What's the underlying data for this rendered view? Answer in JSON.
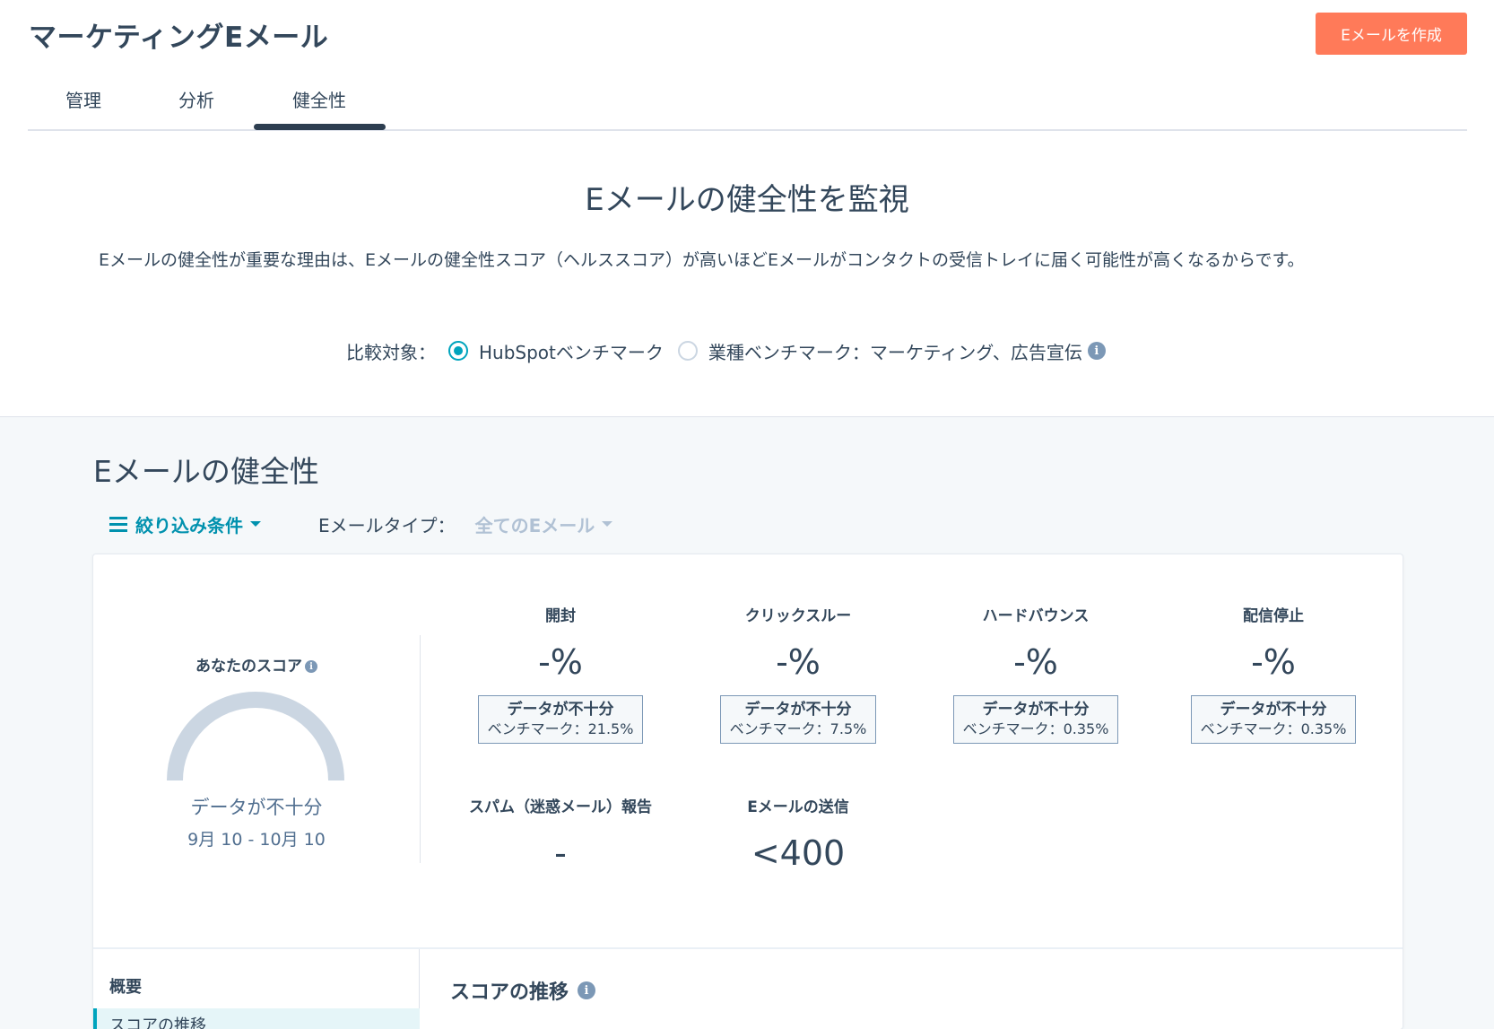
{
  "header": {
    "title": "マーケティングEメール",
    "create_button": "Eメールを作成"
  },
  "tabs": [
    {
      "label": "管理",
      "active": false
    },
    {
      "label": "分析",
      "active": false
    },
    {
      "label": "健全性",
      "active": true
    }
  ],
  "intro": {
    "title": "Eメールの健全性を監視",
    "description": "Eメールの健全性が重要な理由は、Eメールの健全性スコア（ヘルススコア）が高いほどEメールがコンタクトの受信トレイに届く可能性が高くなるからです。",
    "compare_label": "比較対象：",
    "options": [
      {
        "label": "HubSpotベンチマーク",
        "selected": true
      },
      {
        "label": "業種ベンチマーク：マーケティング、広告宣伝",
        "selected": false
      }
    ]
  },
  "health": {
    "title": "Eメールの健全性",
    "filter_label": "絞り込み条件",
    "email_type_label": "Eメールタイプ：",
    "email_type_value": "全てのEメール",
    "score": {
      "title": "あなたのスコア",
      "status": "データが不十分",
      "range": "9月 10 - 10月 10"
    },
    "metrics": [
      {
        "label": "開封",
        "value": "-%",
        "bench_title": "データが不十分",
        "bench_value": "ベンチマーク：21.5%"
      },
      {
        "label": "クリックスルー",
        "value": "-%",
        "bench_title": "データが不十分",
        "bench_value": "ベンチマーク：7.5%"
      },
      {
        "label": "ハードバウンス",
        "value": "-%",
        "bench_title": "データが不十分",
        "bench_value": "ベンチマーク：0.35%"
      },
      {
        "label": "配信停止",
        "value": "-%",
        "bench_title": "データが不十分",
        "bench_value": "ベンチマーク：0.35%"
      }
    ],
    "extra_metrics": [
      {
        "label": "スパム（迷惑メール）報告",
        "value": "-"
      },
      {
        "label": "Eメールの送信",
        "value": "<400"
      }
    ],
    "footer": {
      "overview": "概要",
      "nav_item": "スコアの推移",
      "trend_title": "スコアの推移"
    }
  },
  "colors": {
    "accent": "#ff7a59",
    "teal": "#00a4bd",
    "text": "#33475b",
    "gauge": "#cbd6e2"
  }
}
